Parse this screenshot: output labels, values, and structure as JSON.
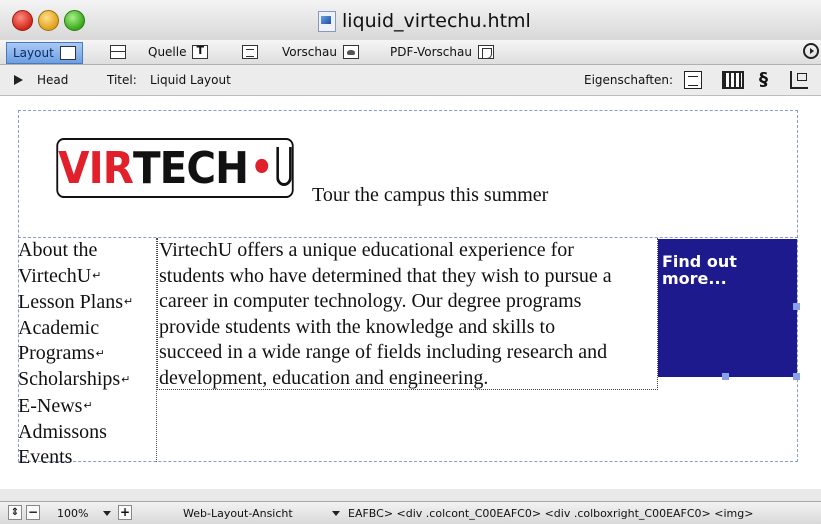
{
  "window": {
    "title": "liquid_virtechu.html"
  },
  "modes": [
    {
      "label": "Layout",
      "icon": "layout-icon",
      "active": true
    },
    {
      "label": "",
      "icon": "split-view-icon",
      "active": false
    },
    {
      "label": "Quelle",
      "icon": "source-text-icon",
      "active": false
    },
    {
      "label": "",
      "icon": "source-lines-icon",
      "active": false
    },
    {
      "label": "Vorschau",
      "icon": "preview-icon",
      "active": false
    },
    {
      "label": "PDF-Vorschau",
      "icon": "pdf-icon",
      "active": false
    }
  ],
  "infobar": {
    "head_label": "Head",
    "title_label": "Titel:",
    "title_value": "Liquid Layout",
    "props_label": "Eigenschaften:"
  },
  "page": {
    "logo_vir": "VIR",
    "logo_tech": "TECH",
    "logo_dot": "•",
    "tagline": "Tour the campus this summer",
    "nav_items": [
      "About the",
      "VirtechU",
      "Lesson Plans",
      "Academic",
      "Programs",
      "Scholarships",
      "E-News",
      "Admissons",
      "Events"
    ],
    "content_lines": [
      "VirtechU offers a unique educational experience for",
      "students who have determined that they wish to pursue a",
      "career in computer technology. Our degree programs",
      "provide students with the knowledge and skills to",
      "succeed in a wide range of fields including research and",
      "development, education and engineering."
    ],
    "promo_line1": "Find out",
    "promo_line2": "more...",
    "promo_color": "#1c1a8c"
  },
  "status": {
    "zoom": "100%",
    "view_mode": "Web-Layout-Ansicht",
    "tag_path": "EAFBC>  <div .colcont_C00EAFC0>  <div .colboxright_C00EAFC0>  <img>"
  }
}
